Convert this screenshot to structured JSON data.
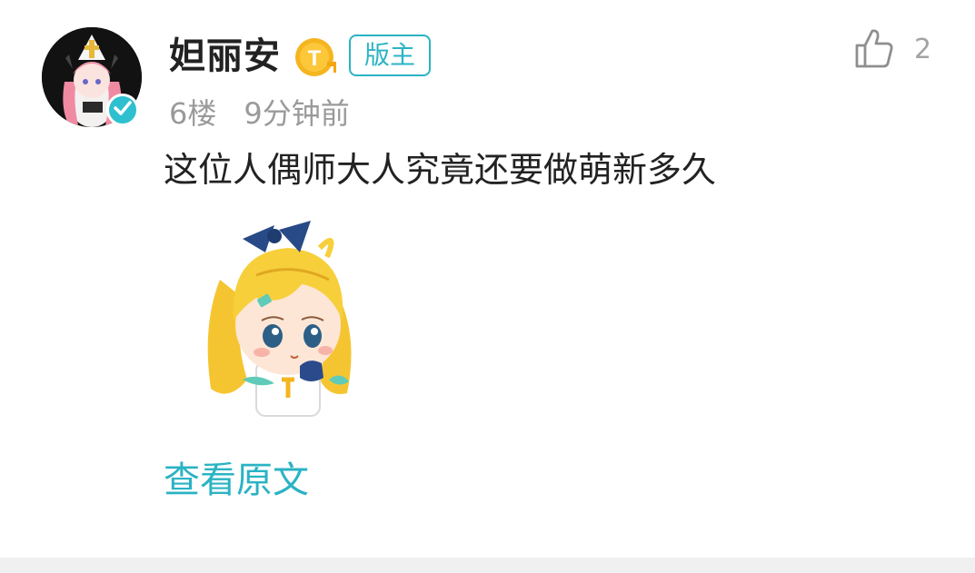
{
  "user": {
    "name": "妲丽安",
    "level_badge_letter": "T",
    "role_badge": "版主",
    "verified_icon": "check-icon"
  },
  "meta": {
    "floor": "6楼",
    "time": "9分钟前"
  },
  "like": {
    "icon": "thumbs-up-icon",
    "count": "2"
  },
  "content": {
    "text": "这位人偶师大人究竟还要做萌新多久"
  },
  "actions": {
    "view_original": "查看原文"
  },
  "colors": {
    "accent": "#2ab3c4",
    "badge_gold": "#f5b51f",
    "meta_gray": "#9a9a9a",
    "text": "#222222"
  }
}
